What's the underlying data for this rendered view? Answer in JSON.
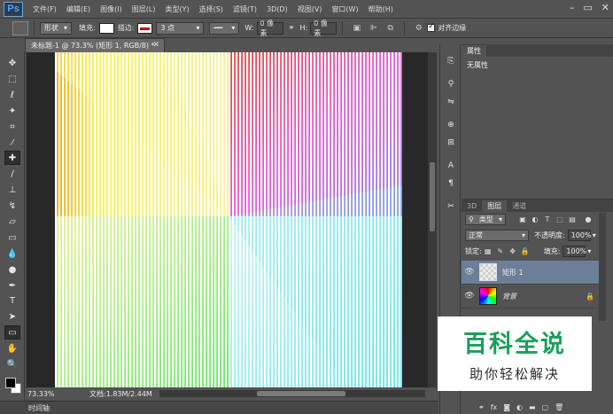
{
  "app": {
    "logo": "Ps"
  },
  "menu": [
    "文件(F)",
    "编辑(E)",
    "图像(I)",
    "图层(L)",
    "类型(Y)",
    "选择(S)",
    "滤镜(T)",
    "3D(D)",
    "视图(V)",
    "窗口(W)",
    "帮助(H)"
  ],
  "window_controls": {
    "minimize": "–",
    "maximize": "▭",
    "close": "✕"
  },
  "options": {
    "mode": "形状",
    "fill_label": "填充:",
    "stroke_label": "描边:",
    "stroke_size": "3 点",
    "w_label": "W:",
    "w_value": "0 像素",
    "h_label": "H:",
    "h_value": "0 像素",
    "align_edges": "对齐边缘"
  },
  "document": {
    "tab_title": "未标题-1 @ 73.3% (矩形 1, RGB/8) *",
    "zoom": "73.33%",
    "doc_info": "文档:1.83M/2.44M"
  },
  "timeline_label": "时间轴",
  "properties": {
    "tab": "属性",
    "body": "无属性"
  },
  "layers": {
    "tabs": [
      "3D",
      "图层",
      "通道"
    ],
    "filter_kind": "类型",
    "blend_mode": "正常",
    "opacity_label": "不透明度:",
    "opacity_value": "100%",
    "lock_label": "锁定:",
    "fill_label": "填充:",
    "fill_value": "100%",
    "items": [
      {
        "name": "矩形 1",
        "selected": true
      },
      {
        "name": "背景",
        "locked": true
      }
    ]
  },
  "watermark": {
    "title": "百科全说",
    "subtitle": "助你轻松解决"
  },
  "colors": {
    "ui_gray": "#535353",
    "selected_layer": "#6b7f98",
    "watermark_green": "#1aa05a"
  }
}
